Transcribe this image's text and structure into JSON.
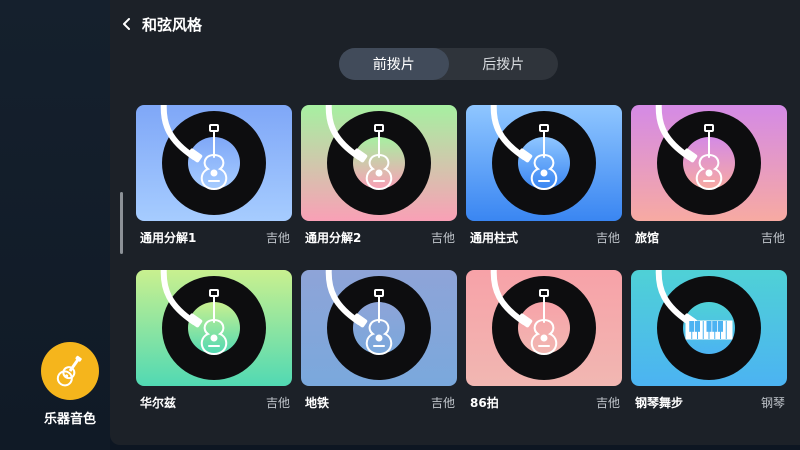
{
  "header": {
    "title": "和弦风格",
    "back_icon": "chevron-left-icon"
  },
  "tabs": [
    {
      "label": "前拨片",
      "active": true
    },
    {
      "label": "后拨片",
      "active": false
    }
  ],
  "cards": [
    {
      "name": "通用分解1",
      "tag": "吉他",
      "icon": "guitar-icon",
      "gradient": [
        "#7fa7f7",
        "#a6ccff"
      ]
    },
    {
      "name": "通用分解2",
      "tag": "吉他",
      "icon": "guitar-icon",
      "gradient": [
        "#a6f0a1",
        "#f9a0b6"
      ]
    },
    {
      "name": "通用柱式",
      "tag": "吉他",
      "icon": "guitar-icon",
      "gradient": [
        "#8fc6ff",
        "#3a86f2"
      ]
    },
    {
      "name": "旅馆",
      "tag": "吉他",
      "icon": "guitar-icon",
      "gradient": [
        "#d48ae6",
        "#f7aaa2"
      ]
    },
    {
      "name": "华尔兹",
      "tag": "吉他",
      "icon": "guitar-icon",
      "gradient": [
        "#c9f08f",
        "#51d9b3"
      ]
    },
    {
      "name": "地铁",
      "tag": "吉他",
      "icon": "guitar-icon",
      "gradient": [
        "#8ea4d8",
        "#7aa8dc"
      ]
    },
    {
      "name": "86拍",
      "tag": "吉他",
      "icon": "guitar-icon",
      "gradient": [
        "#f7a2a8",
        "#f1b7b2"
      ]
    },
    {
      "name": "钢琴舞步",
      "tag": "钢琴",
      "icon": "piano-icon",
      "gradient": [
        "#4fd1d6",
        "#4cb3f2"
      ]
    }
  ],
  "instrument": {
    "label": "乐器音色",
    "icon": "guitar-icon",
    "color": "#f5b51c"
  }
}
